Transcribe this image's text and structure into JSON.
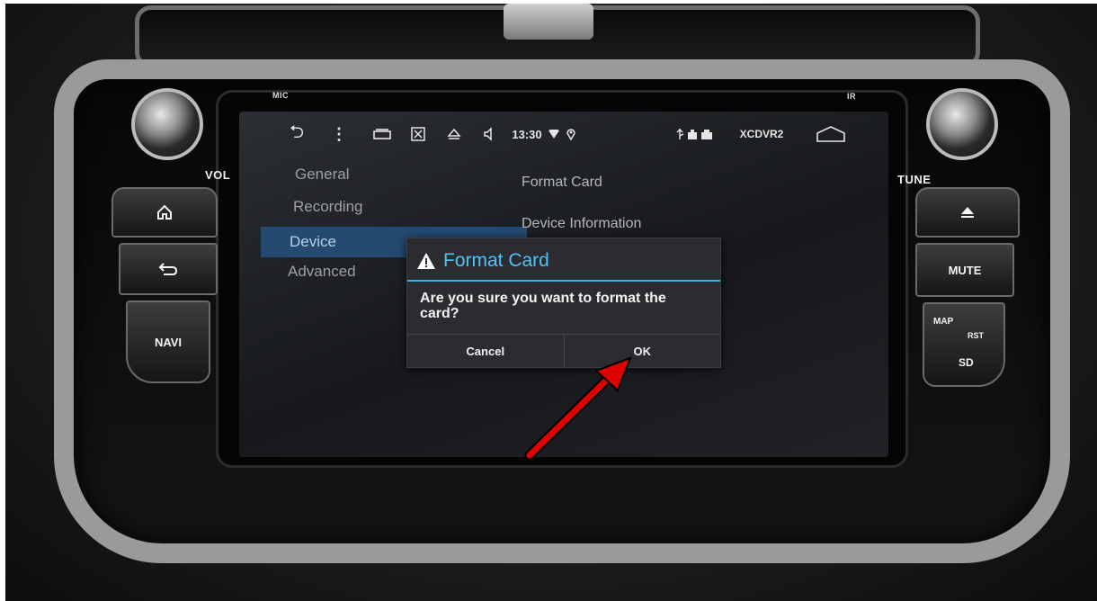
{
  "dashboard": {
    "vol_label": "VOL",
    "tune_label": "TUNE",
    "mic_label": "MIC",
    "ir_label": "IR",
    "buttons": {
      "home_icon": "home-icon",
      "back_icon": "back-icon",
      "navi": "NAVI",
      "eject_icon": "eject-icon",
      "mute": "MUTE",
      "map": "MAP",
      "rst": "RST",
      "sd": "SD"
    }
  },
  "statusbar": {
    "back": "⮌",
    "menu": "⋮",
    "time": "13:30",
    "app": "XCDVR2"
  },
  "settings_menu": {
    "items": [
      "General",
      "Recording",
      "Device",
      "Advanced"
    ],
    "selected": "Device"
  },
  "device_panel": {
    "items": [
      "Format Card",
      "Device Information"
    ]
  },
  "dialog": {
    "title": "Format Card",
    "message": "Are you sure you want to format the card?",
    "cancel_label": "Cancel",
    "ok_label": "OK"
  },
  "colors": {
    "accent": "#4fc3f7",
    "selected_bg": "#254a72",
    "arrow": "#e00000"
  }
}
